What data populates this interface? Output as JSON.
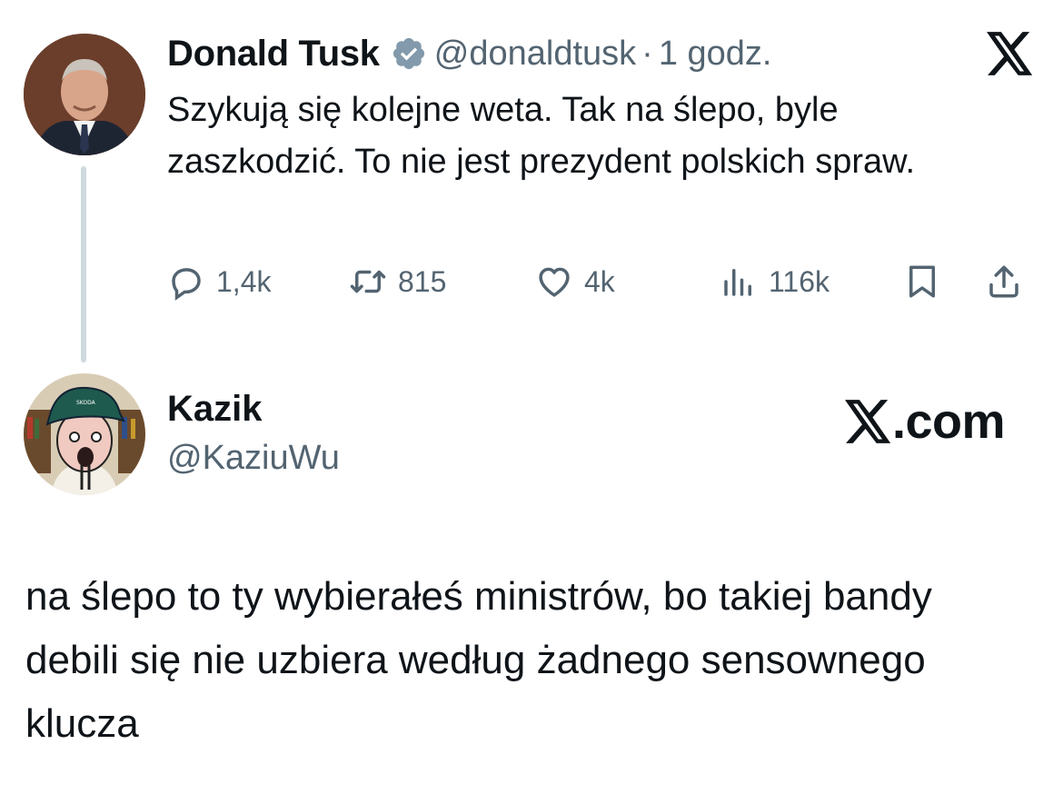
{
  "tweet": {
    "author_name": "Donald Tusk",
    "handle": "@donaldtusk",
    "separator": "·",
    "time": "1 godz.",
    "text": "Szykują się kolejne weta. Tak na ślepo, byle zaszkodzić. To nie jest prezydent polskich spraw.",
    "stats": {
      "replies": "1,4k",
      "reposts": "815",
      "likes": "4k",
      "views": "116k"
    },
    "icons": [
      "verified-badge-icon",
      "x-logo-icon",
      "reply-icon",
      "repost-icon",
      "like-icon",
      "views-icon",
      "bookmark-icon",
      "share-icon"
    ]
  },
  "reply": {
    "author_name": "Kazik",
    "handle": "@KaziuWu",
    "brand": ".com",
    "text": "na ślepo to ty wybierałeś ministrów, bo takiej bandy debili się nie uzbiera według żadnego sensownego klucza"
  },
  "colors": {
    "text": "#0f1419",
    "secondary": "#536471",
    "verified": "#829aab",
    "thread_line": "#cfd9de"
  }
}
